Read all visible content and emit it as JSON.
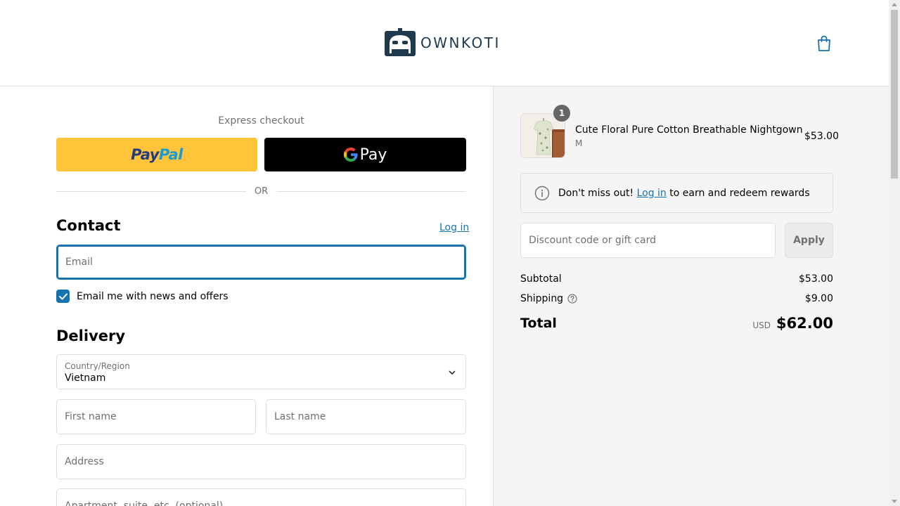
{
  "header": {
    "brand": "OWNKOTI"
  },
  "express": {
    "title": "Express checkout",
    "paypal_label_a": "Pay",
    "paypal_label_b": "Pal",
    "gpay_label": "Pay",
    "or_text": "OR"
  },
  "contact": {
    "title": "Contact",
    "login_label": "Log in",
    "email_placeholder": "Email",
    "newsletter_label": "Email me with news and offers",
    "newsletter_checked": true
  },
  "delivery": {
    "title": "Delivery",
    "country_label": "Country/Region",
    "country_value": "Vietnam",
    "first_name_placeholder": "First name",
    "last_name_placeholder": "Last name",
    "address_placeholder": "Address",
    "apartment_placeholder": "Apartment, suite, etc. (optional)"
  },
  "order": {
    "quantity": "1",
    "product_name": "Cute Floral Pure Cotton Breathable Nightgown",
    "product_variant": "M",
    "product_price": "$53.00",
    "rewards_prefix": "Don't miss out!",
    "rewards_link": "Log in",
    "rewards_suffix": "to earn and redeem rewards",
    "discount_placeholder": "Discount code or gift card",
    "apply_label": "Apply",
    "subtotal_label": "Subtotal",
    "subtotal_value": "$53.00",
    "shipping_label": "Shipping",
    "shipping_value": "$9.00",
    "total_label": "Total",
    "currency": "USD",
    "total_value": "$62.00"
  },
  "colors": {
    "accent": "#1773b0",
    "paypal_yellow": "#ffc439",
    "summary_bg": "#f5f5f5"
  }
}
